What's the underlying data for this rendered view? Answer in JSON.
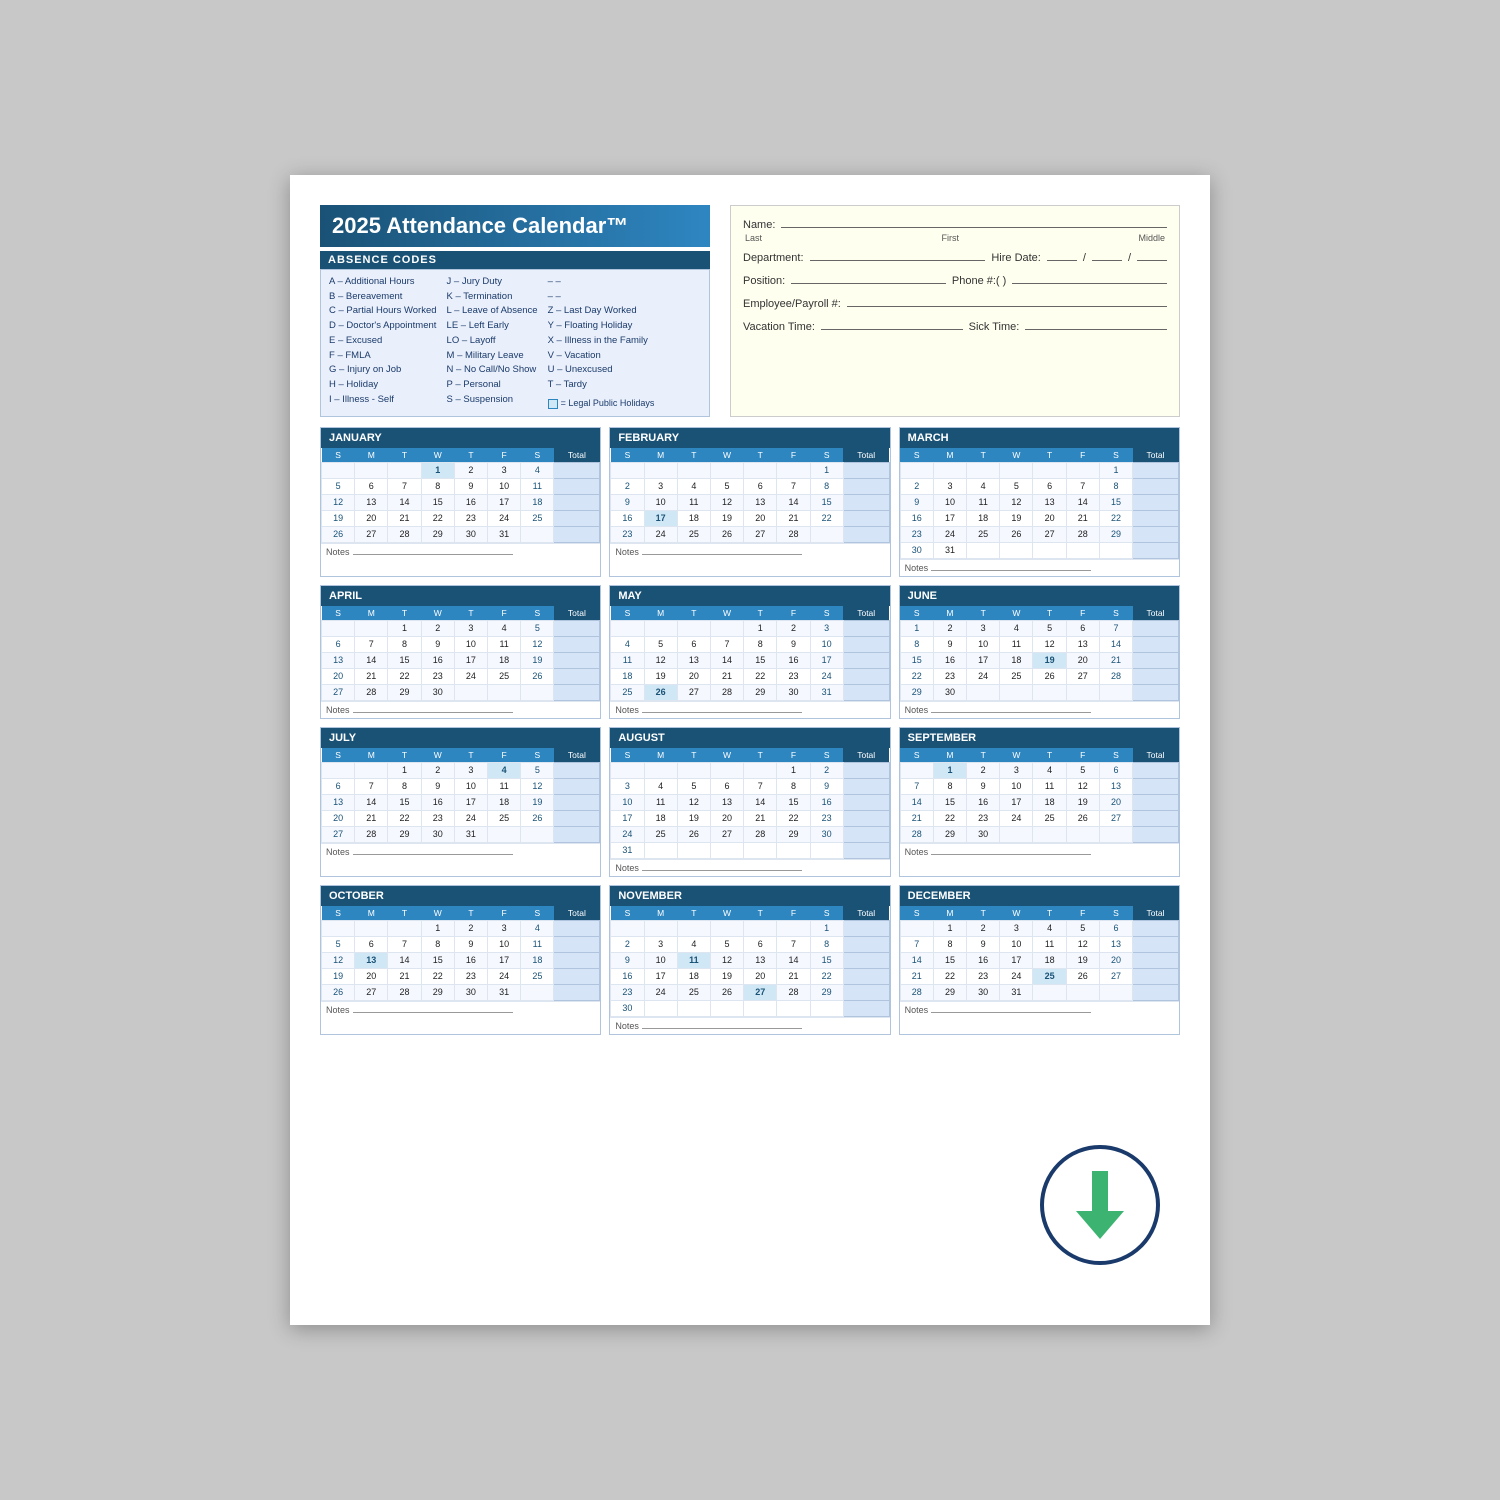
{
  "title": "2025 Attendance Calendar™",
  "absence_codes_header": "ABSENCE CODES",
  "codes_col1": [
    "A – Additional Hours",
    "B – Bereavement",
    "C – Partial Hours Worked",
    "D – Doctor's Appointment",
    "E – Excused",
    "F – FMLA",
    "G – Injury on Job",
    "H – Holiday",
    "I – Illness - Self"
  ],
  "codes_col2": [
    "J – Jury Duty",
    "K – Termination",
    "L – Leave of Absence",
    "LE – Left Early",
    "LO – Layoff",
    "M – Military Leave",
    "N – No Call/No Show",
    "P – Personal",
    "S – Suspension"
  ],
  "codes_col3": [
    "T – Tardy",
    "U – Unexcused",
    "V – Vacation",
    "X – Illness in the Family",
    "Y – Floating Holiday",
    "Z – Last Day Worked",
    "– –",
    "– –"
  ],
  "legend_label": "= Legal Public Holidays",
  "fields": {
    "name_label": "Name:",
    "last_label": "Last",
    "first_label": "First",
    "middle_label": "Middle",
    "dept_label": "Department:",
    "hire_label": "Hire Date:",
    "position_label": "Position:",
    "phone_label": "Phone #:(    )",
    "emp_label": "Employee/Payroll #:",
    "vac_label": "Vacation Time:",
    "sick_label": "Sick Time:"
  },
  "months": [
    {
      "name": "JANUARY",
      "days_header": [
        "S",
        "M",
        "T",
        "W",
        "T",
        "F",
        "S",
        "Total"
      ],
      "weeks": [
        [
          "",
          "",
          "",
          "1",
          "2",
          "3",
          "4",
          ""
        ],
        [
          "5",
          "6",
          "7",
          "8",
          "9",
          "10",
          "11",
          ""
        ],
        [
          "12",
          "13",
          "14",
          "15",
          "16",
          "17",
          "18",
          ""
        ],
        [
          "19",
          "20",
          "21",
          "22",
          "23",
          "24",
          "25",
          ""
        ],
        [
          "26",
          "27",
          "28",
          "29",
          "30",
          "31",
          "",
          ""
        ]
      ],
      "holiday_days": [
        "1"
      ],
      "notes": "Notes"
    },
    {
      "name": "FEBRUARY",
      "days_header": [
        "S",
        "M",
        "T",
        "W",
        "T",
        "F",
        "S",
        "Total"
      ],
      "weeks": [
        [
          "",
          "",
          "",
          "",
          "",
          "",
          "1",
          ""
        ],
        [
          "2",
          "3",
          "4",
          "5",
          "6",
          "7",
          "8",
          ""
        ],
        [
          "9",
          "10",
          "11",
          "12",
          "13",
          "14",
          "15",
          ""
        ],
        [
          "16",
          "17",
          "18",
          "19",
          "20",
          "21",
          "22",
          ""
        ],
        [
          "23",
          "24",
          "25",
          "26",
          "27",
          "28",
          "",
          ""
        ]
      ],
      "holiday_days": [
        "17"
      ],
      "notes": "Notes"
    },
    {
      "name": "MARCH",
      "days_header": [
        "S",
        "M",
        "T",
        "W",
        "T",
        "F",
        "S",
        "Total"
      ],
      "weeks": [
        [
          "",
          "",
          "",
          "",
          "",
          "",
          "1",
          ""
        ],
        [
          "2",
          "3",
          "4",
          "5",
          "6",
          "7",
          "8",
          ""
        ],
        [
          "9",
          "10",
          "11",
          "12",
          "13",
          "14",
          "15",
          ""
        ],
        [
          "16",
          "17",
          "18",
          "19",
          "20",
          "21",
          "22",
          ""
        ],
        [
          "23",
          "24",
          "25",
          "26",
          "27",
          "28",
          "29",
          ""
        ],
        [
          "30",
          "31",
          "",
          "",
          "",
          "",
          "",
          ""
        ]
      ],
      "holiday_days": [],
      "notes": "Notes"
    },
    {
      "name": "APRIL",
      "days_header": [
        "S",
        "M",
        "T",
        "W",
        "T",
        "F",
        "S",
        "Total"
      ],
      "weeks": [
        [
          "",
          "",
          "1",
          "2",
          "3",
          "4",
          "5",
          ""
        ],
        [
          "6",
          "7",
          "8",
          "9",
          "10",
          "11",
          "12",
          ""
        ],
        [
          "13",
          "14",
          "15",
          "16",
          "17",
          "18",
          "19",
          ""
        ],
        [
          "20",
          "21",
          "22",
          "23",
          "24",
          "25",
          "26",
          ""
        ],
        [
          "27",
          "28",
          "29",
          "30",
          "",
          "",
          "",
          ""
        ]
      ],
      "holiday_days": [],
      "notes": "Notes"
    },
    {
      "name": "MAY",
      "days_header": [
        "S",
        "M",
        "T",
        "W",
        "T",
        "F",
        "S",
        "Total"
      ],
      "weeks": [
        [
          "",
          "",
          "",
          "",
          "1",
          "2",
          "3",
          ""
        ],
        [
          "4",
          "5",
          "6",
          "7",
          "8",
          "9",
          "10",
          ""
        ],
        [
          "11",
          "12",
          "13",
          "14",
          "15",
          "16",
          "17",
          ""
        ],
        [
          "18",
          "19",
          "20",
          "21",
          "22",
          "23",
          "24",
          ""
        ],
        [
          "25",
          "26",
          "27",
          "28",
          "29",
          "30",
          "31",
          ""
        ]
      ],
      "holiday_days": [
        "26"
      ],
      "notes": "Notes"
    },
    {
      "name": "JUNE",
      "days_header": [
        "S",
        "M",
        "T",
        "W",
        "T",
        "F",
        "S",
        "Total"
      ],
      "weeks": [
        [
          "1",
          "2",
          "3",
          "4",
          "5",
          "6",
          "7",
          ""
        ],
        [
          "8",
          "9",
          "10",
          "11",
          "12",
          "13",
          "14",
          ""
        ],
        [
          "15",
          "16",
          "17",
          "18",
          "19",
          "20",
          "21",
          ""
        ],
        [
          "22",
          "23",
          "24",
          "25",
          "26",
          "27",
          "28",
          ""
        ],
        [
          "29",
          "30",
          "",
          "",
          "",
          "",
          "",
          ""
        ]
      ],
      "holiday_days": [
        "19"
      ],
      "notes": "Notes"
    },
    {
      "name": "JULY",
      "days_header": [
        "S",
        "M",
        "T",
        "W",
        "T",
        "F",
        "S",
        "Total"
      ],
      "weeks": [
        [
          "",
          "",
          "1",
          "2",
          "3",
          "4",
          "5",
          ""
        ],
        [
          "6",
          "7",
          "8",
          "9",
          "10",
          "11",
          "12",
          ""
        ],
        [
          "13",
          "14",
          "15",
          "16",
          "17",
          "18",
          "19",
          ""
        ],
        [
          "20",
          "21",
          "22",
          "23",
          "24",
          "25",
          "26",
          ""
        ],
        [
          "27",
          "28",
          "29",
          "30",
          "31",
          "",
          "",
          ""
        ]
      ],
      "holiday_days": [
        "4"
      ],
      "notes": "Notes"
    },
    {
      "name": "AUGUST",
      "days_header": [
        "S",
        "M",
        "T",
        "W",
        "T",
        "F",
        "S",
        "Total"
      ],
      "weeks": [
        [
          "",
          "",
          "",
          "",
          "",
          "1",
          "2",
          ""
        ],
        [
          "3",
          "4",
          "5",
          "6",
          "7",
          "8",
          "9",
          ""
        ],
        [
          "10",
          "11",
          "12",
          "13",
          "14",
          "15",
          "16",
          ""
        ],
        [
          "17",
          "18",
          "19",
          "20",
          "21",
          "22",
          "23",
          ""
        ],
        [
          "24",
          "25",
          "26",
          "27",
          "28",
          "29",
          "30",
          ""
        ],
        [
          "31",
          "",
          "",
          "",
          "",
          "",
          "",
          ""
        ]
      ],
      "holiday_days": [],
      "notes": "Notes"
    },
    {
      "name": "SEPTEMBER",
      "days_header": [
        "S",
        "M",
        "T",
        "W",
        "T",
        "F",
        "S",
        "Total"
      ],
      "weeks": [
        [
          "",
          "1",
          "2",
          "3",
          "4",
          "5",
          "6",
          ""
        ],
        [
          "7",
          "8",
          "9",
          "10",
          "11",
          "12",
          "13",
          ""
        ],
        [
          "14",
          "15",
          "16",
          "17",
          "18",
          "19",
          "20",
          ""
        ],
        [
          "21",
          "22",
          "23",
          "24",
          "25",
          "26",
          "27",
          ""
        ],
        [
          "28",
          "29",
          "30",
          "",
          "",
          "",
          "",
          ""
        ]
      ],
      "holiday_days": [
        "1"
      ],
      "notes": "Notes"
    },
    {
      "name": "OCTOBER",
      "days_header": [
        "S",
        "M",
        "T",
        "W",
        "T",
        "F",
        "S",
        "Total"
      ],
      "weeks": [
        [
          "",
          "",
          "",
          "1",
          "2",
          "3",
          "4",
          ""
        ],
        [
          "5",
          "6",
          "7",
          "8",
          "9",
          "10",
          "11",
          ""
        ],
        [
          "12",
          "13",
          "14",
          "15",
          "16",
          "17",
          "18",
          ""
        ],
        [
          "19",
          "20",
          "21",
          "22",
          "23",
          "24",
          "25",
          ""
        ],
        [
          "26",
          "27",
          "28",
          "29",
          "30",
          "31",
          "",
          ""
        ]
      ],
      "holiday_days": [
        "13"
      ],
      "notes": "Notes"
    },
    {
      "name": "NOVEMBER",
      "days_header": [
        "S",
        "M",
        "T",
        "W",
        "T",
        "F",
        "S",
        "Total"
      ],
      "weeks": [
        [
          "",
          "",
          "",
          "",
          "",
          "",
          "1",
          ""
        ],
        [
          "2",
          "3",
          "4",
          "5",
          "6",
          "7",
          "8",
          ""
        ],
        [
          "9",
          "10",
          "11",
          "12",
          "13",
          "14",
          "15",
          ""
        ],
        [
          "16",
          "17",
          "18",
          "19",
          "20",
          "21",
          "22",
          ""
        ],
        [
          "23",
          "24",
          "25",
          "26",
          "27",
          "28",
          "29",
          ""
        ],
        [
          "30",
          "",
          "",
          "",
          "",
          "",
          "",
          ""
        ]
      ],
      "holiday_days": [
        "11",
        "27"
      ],
      "notes": "Notes"
    },
    {
      "name": "DECEMBER",
      "days_header": [
        "S",
        "M",
        "T",
        "W",
        "T",
        "F",
        "S",
        "Total"
      ],
      "weeks": [
        [
          "",
          "1",
          "2",
          "3",
          "4",
          "5",
          "6",
          ""
        ],
        [
          "7",
          "8",
          "9",
          "10",
          "11",
          "12",
          "13",
          ""
        ],
        [
          "14",
          "15",
          "16",
          "17",
          "18",
          "19",
          "20",
          ""
        ],
        [
          "21",
          "22",
          "23",
          "24",
          "25",
          "26",
          "27",
          ""
        ],
        [
          "28",
          "29",
          "30",
          "31",
          "",
          "",
          "",
          ""
        ]
      ],
      "holiday_days": [
        "25"
      ],
      "notes": "Notes"
    }
  ]
}
